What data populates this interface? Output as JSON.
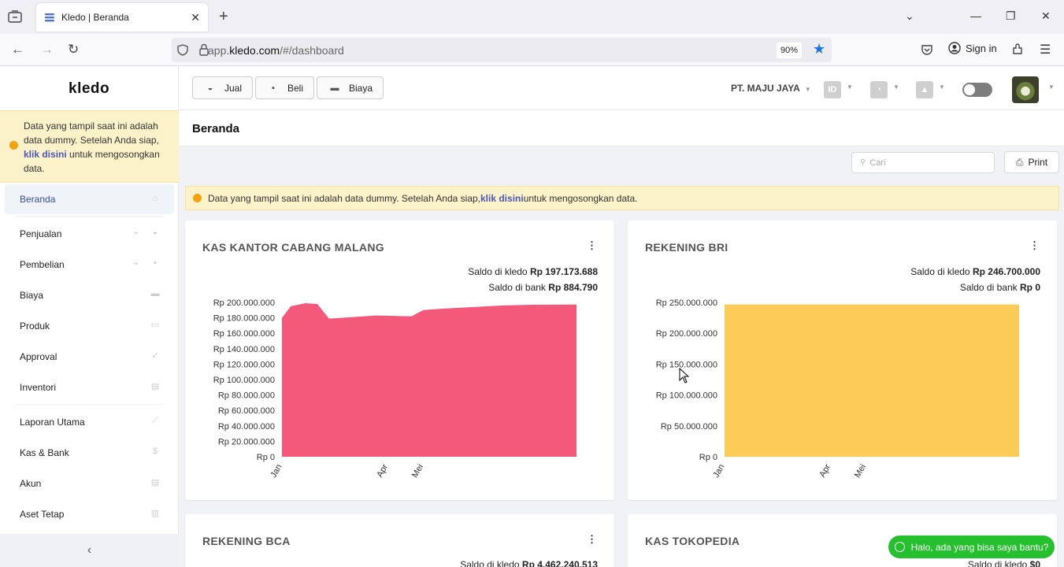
{
  "browser": {
    "tab_title": "Kledo | Beranda",
    "url_prefix": "app.",
    "url_domain": "kledo.com",
    "url_path": "/#/dashboard",
    "zoom": "90%",
    "signin": "Sign in"
  },
  "sidebar": {
    "logo": "kledo",
    "notice": {
      "text_before": "Data yang tampil saat ini adalah data dummy. Setelah Anda siap, ",
      "link": "klik disini",
      "text_after": " untuk mengosongkan data."
    },
    "items": [
      {
        "label": "Beranda",
        "icon": "home-icon",
        "active": true
      },
      {
        "label": "Penjualan",
        "icon": "basket-icon",
        "chevron": true
      },
      {
        "label": "Pembelian",
        "icon": "bag-icon",
        "chevron": true
      },
      {
        "label": "Biaya",
        "icon": "card-icon"
      },
      {
        "label": "Produk",
        "icon": "box-icon"
      },
      {
        "label": "Approval",
        "icon": "check-icon"
      },
      {
        "label": "Inventori",
        "icon": "warehouse-icon"
      },
      {
        "label": "Laporan Utama",
        "icon": "chart-icon"
      },
      {
        "label": "Kas & Bank",
        "icon": "dollar-icon"
      },
      {
        "label": "Akun",
        "icon": "ledger-icon"
      },
      {
        "label": "Aset Tetap",
        "icon": "building-icon"
      }
    ],
    "collapse_icon": "chevron-left-icon"
  },
  "topbar": {
    "buttons": [
      {
        "label": "Jual",
        "icon": "basket-icon"
      },
      {
        "label": "Beli",
        "icon": "bag-icon"
      },
      {
        "label": "Biaya",
        "icon": "card-icon"
      }
    ],
    "company": "PT. MAJU JAYA",
    "lang": "ID"
  },
  "page": {
    "title": "Beranda",
    "search_placeholder": "Cari",
    "print_label": "Print",
    "banner": {
      "text_before": "Data yang tampil saat ini adalah data dummy. Setelah Anda siap, ",
      "link": "klik disini",
      "text_after": " untuk mengosongkan data."
    }
  },
  "cards": [
    {
      "title": "KAS KANTOR CABANG MALANG",
      "saldo_kledo_label": "Saldo di kledo",
      "saldo_kledo": "Rp 197.173.688",
      "saldo_bank_label": "Saldo di bank",
      "saldo_bank": "Rp 884.790"
    },
    {
      "title": "REKENING BRI",
      "saldo_kledo_label": "Saldo di kledo",
      "saldo_kledo": "Rp 246.700.000",
      "saldo_bank_label": "Saldo di bank",
      "saldo_bank": "Rp 0"
    },
    {
      "title": "REKENING BCA",
      "saldo_kledo_label": "Saldo di kledo",
      "saldo_kledo": "Rp 4.462.240.513"
    },
    {
      "title": "KAS TOKOPEDIA",
      "saldo_kledo_label": "Saldo di kledo",
      "saldo_kledo": "$0"
    }
  ],
  "chart_data": [
    {
      "type": "area",
      "title": "KAS KANTOR CABANG MALANG",
      "color": "#f4587a",
      "ylim": [
        0,
        200000000
      ],
      "yticks": [
        "Rp 200.000.000",
        "Rp 180.000.000",
        "Rp 160.000.000",
        "Rp 140.000.000",
        "Rp 120.000.000",
        "Rp 100.000.000",
        "Rp 80.000.000",
        "Rp 60.000.000",
        "Rp 40.000.000",
        "Rp 20.000.000",
        "Rp 0"
      ],
      "xticks": [
        {
          "label": "Jan",
          "x": 0
        },
        {
          "label": "Apr",
          "x": 0.36
        },
        {
          "label": "Mei",
          "x": 0.48
        }
      ],
      "x": [
        0,
        0.03,
        0.08,
        0.12,
        0.16,
        0.24,
        0.32,
        0.44,
        0.48,
        0.55,
        0.65,
        0.75,
        0.85,
        1.0
      ],
      "values": [
        180000000,
        195000000,
        199000000,
        198000000,
        179000000,
        181000000,
        183000000,
        182000000,
        190000000,
        192000000,
        194000000,
        196000000,
        197000000,
        197200000
      ]
    },
    {
      "type": "area",
      "title": "REKENING BRI",
      "color": "#fdcb57",
      "ylim": [
        0,
        250000000
      ],
      "yticks": [
        "Rp 250.000.000",
        "Rp 200.000.000",
        "Rp 150.000.000",
        "Rp 100.000.000",
        "Rp 50.000.000",
        "Rp 0"
      ],
      "xticks": [
        {
          "label": "Jan",
          "x": 0
        },
        {
          "label": "Apr",
          "x": 0.36
        },
        {
          "label": "Mei",
          "x": 0.48
        }
      ],
      "x": [
        0,
        1.0
      ],
      "values": [
        246700000,
        246700000
      ]
    }
  ],
  "whatsapp": {
    "label": "Halo, ada yang bisa saya bantu?"
  }
}
